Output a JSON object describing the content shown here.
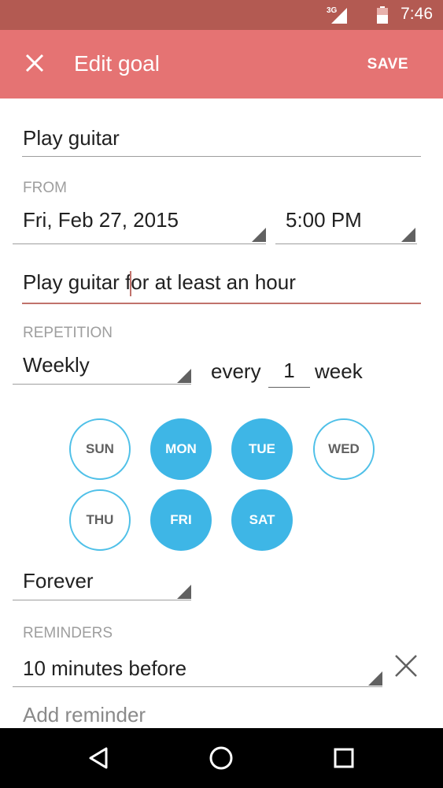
{
  "status_bar": {
    "network": "3G",
    "time": "7:46"
  },
  "app_bar": {
    "close_icon": "close-icon",
    "title": "Edit goal",
    "save_label": "SAVE"
  },
  "form": {
    "title_value": "Play guitar",
    "from_label": "FROM",
    "from_date": "Fri, Feb 27, 2015",
    "from_time": "5:00 PM",
    "description_value": "Play guitar for at least an hour",
    "repetition_label": "REPETITION",
    "repetition_value": "Weekly",
    "every_label": "every",
    "interval_value": "1",
    "interval_unit": "week",
    "days": [
      {
        "label": "SUN",
        "selected": false
      },
      {
        "label": "MON",
        "selected": true
      },
      {
        "label": "TUE",
        "selected": true
      },
      {
        "label": "WED",
        "selected": false
      },
      {
        "label": "THU",
        "selected": false
      },
      {
        "label": "FRI",
        "selected": true
      },
      {
        "label": "SAT",
        "selected": true
      }
    ],
    "end_value": "Forever",
    "reminders_label": "REMINDERS",
    "reminder_value": "10 minutes before",
    "add_reminder_label": "Add reminder"
  },
  "colors": {
    "status_bar": "#b35a52",
    "app_bar": "#e57373",
    "accent": "#c0726c",
    "day_selected": "#3eb6e6",
    "day_outline": "#4fc0e8"
  }
}
